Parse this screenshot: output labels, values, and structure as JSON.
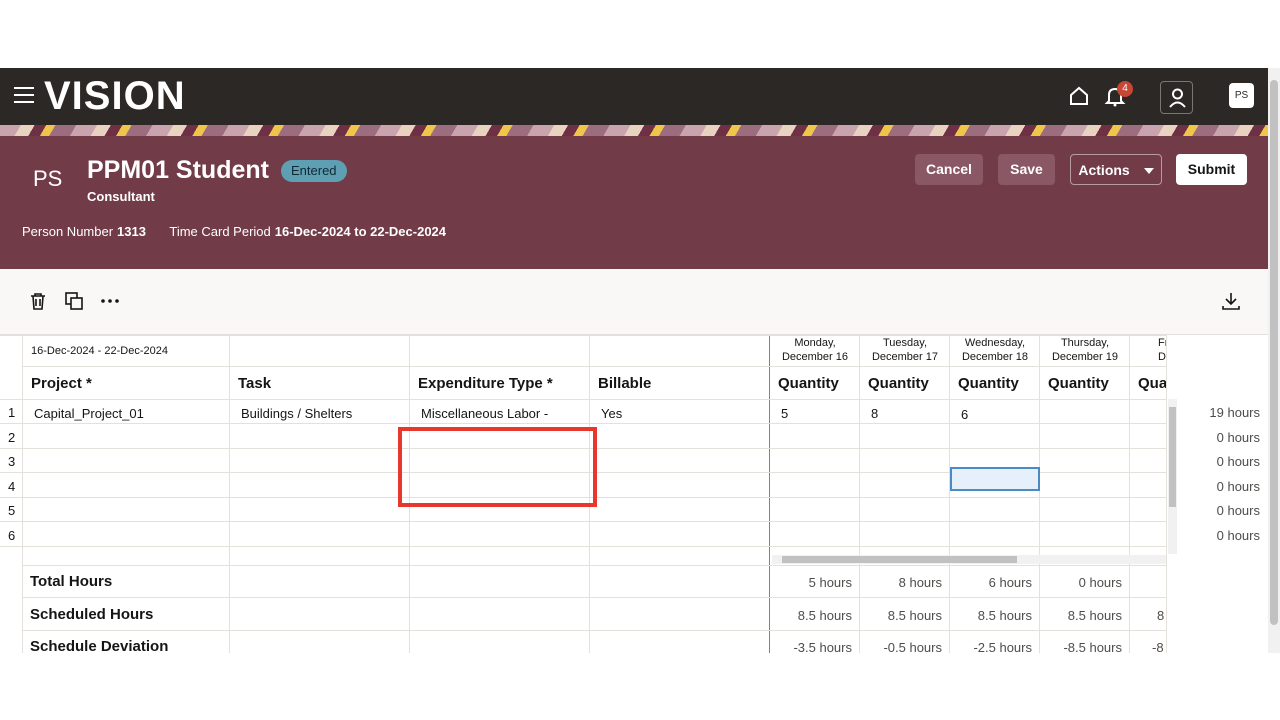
{
  "app": {
    "logo": "VISION",
    "notification_count": "4",
    "avatar_initials": "PS"
  },
  "header": {
    "initials": "PS",
    "name": "PPM01 Student",
    "status": "Entered",
    "role": "Consultant",
    "person_number_label": "Person Number",
    "person_number": "1313",
    "period_label": "Time Card Period",
    "period": "16-Dec-2024 to 22-Dec-2024",
    "buttons": {
      "cancel": "Cancel",
      "save": "Save",
      "actions": "Actions",
      "submit": "Submit"
    }
  },
  "grid": {
    "range": "16-Dec-2024 - 22-Dec-2024",
    "columns": {
      "project": "Project *",
      "task": "Task",
      "expenditure": "Expenditure Type *",
      "billable": "Billable"
    },
    "days": [
      {
        "line1": "Monday,",
        "line2": "December 16",
        "label": "Quantity"
      },
      {
        "line1": "Tuesday,",
        "line2": "December 17",
        "label": "Quantity"
      },
      {
        "line1": "Wednesday,",
        "line2": "December 18",
        "label": "Quantity"
      },
      {
        "line1": "Thursday,",
        "line2": "December 19",
        "label": "Quantity"
      },
      {
        "line1": "Fr",
        "line2": "Dece",
        "label": "Qua"
      }
    ],
    "row1": {
      "num": "1",
      "project": "Capital_Project_01",
      "task": "Buildings / Shelters",
      "expenditure": "Miscellaneous Labor -",
      "billable": "Yes",
      "mon": "5",
      "tue": "8",
      "wed": "6"
    },
    "row_numbers": [
      "2",
      "3",
      "4",
      "5",
      "6"
    ],
    "row_hours": [
      "19 hours",
      "0 hours",
      "0 hours",
      "0 hours",
      "0 hours",
      "0 hours"
    ],
    "footer": {
      "total_label": "Total Hours",
      "total": [
        "5 hours",
        "8 hours",
        "6 hours",
        "0 hours"
      ],
      "scheduled_label": "Scheduled Hours",
      "scheduled": [
        "8.5 hours",
        "8.5 hours",
        "8.5 hours",
        "8.5 hours",
        "8"
      ],
      "deviation_label": "Schedule Deviation",
      "deviation": [
        "-3.5 hours",
        "-0.5 hours",
        "-2.5 hours",
        "-8.5 hours",
        "-8"
      ]
    }
  }
}
